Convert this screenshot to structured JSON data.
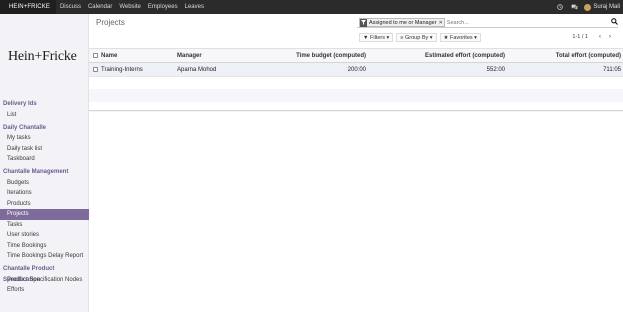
{
  "topbar": {
    "brand": "HEIN+FRICKE",
    "nav": [
      "Discuss",
      "Calendar",
      "Website",
      "Employees",
      "Leaves"
    ],
    "user": "Suraj Mali"
  },
  "sidebar": {
    "logo": "Hein+Fricke",
    "sections": [
      {
        "title": "Delivery Ids",
        "items": [
          "List"
        ]
      },
      {
        "title": "Daily Chantalle",
        "items": [
          "My tasks",
          "Daily task list",
          "Taskboard"
        ]
      },
      {
        "title": "Chantalle Management",
        "items": [
          "Budgets",
          "Iterations",
          "Products",
          "Projects",
          "Tasks",
          "User stories",
          "Time Bookings",
          "Time Bookings Delay Report"
        ]
      },
      {
        "title": "Chantalle Product Specification",
        "items": [
          "Product Specification Nodes",
          "Efforts"
        ]
      }
    ],
    "active_item": "Projects"
  },
  "control_panel": {
    "title": "Projects",
    "facet": "Assigned to me or Manager",
    "search_placeholder": "Search...",
    "filters": "Filters",
    "group_by": "Group By",
    "favorites": "Favorites",
    "pager": "1-1 / 1"
  },
  "table": {
    "columns": [
      "Name",
      "Manager",
      "Time budget (computed)",
      "Estimated effort (computed)",
      "Total effort (computed)"
    ],
    "rows": [
      {
        "name": "Training-Interns",
        "manager": "Aparna Mohod",
        "time_budget": "200:00",
        "estimated_effort": "552:00",
        "total_effort": "711:05"
      }
    ]
  },
  "icons": {
    "clock": "clock-icon",
    "chat": "chat-icon",
    "search": "search-icon",
    "filter": "filter-icon"
  },
  "colors": {
    "accent": "#7c6b9b",
    "section_title": "#6d5a8c",
    "topbar": "#2b2b2b"
  }
}
